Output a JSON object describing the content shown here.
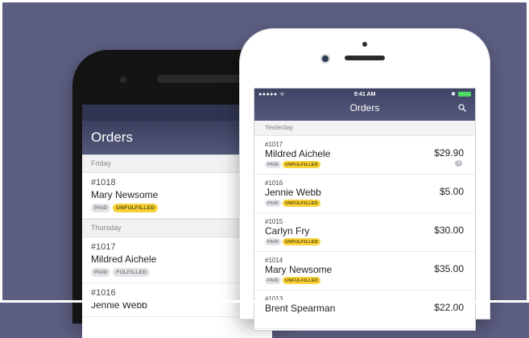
{
  "android": {
    "title": "Orders",
    "sections": [
      {
        "label": "Friday",
        "orders": [
          {
            "number": "#1018",
            "customer": "Mary Newsome",
            "payment": "PAID",
            "fulfillment": "UNFULFILLED"
          }
        ]
      },
      {
        "label": "Thursday",
        "orders": [
          {
            "number": "#1017",
            "customer": "Mildred Aichele",
            "payment": "PAID",
            "fulfillment": "FULFILLED"
          },
          {
            "number": "#1016",
            "customer": "Jennie Webb"
          }
        ]
      }
    ]
  },
  "iphone": {
    "status": {
      "signal": "●●●●● ᯤ",
      "time": "9:41 AM",
      "bluetooth": "✱"
    },
    "title": "Orders",
    "section": "Yesterday",
    "orders": [
      {
        "number": "#1017",
        "customer": "Mildred Aichele",
        "payment": "PAID",
        "fulfillment": "UNFULFILLED",
        "price": "$29.90",
        "comment_count": "3"
      },
      {
        "number": "#1016",
        "customer": "Jennie Webb",
        "payment": "PAID",
        "fulfillment": "UNFULFILLED",
        "price": "$5.00"
      },
      {
        "number": "#1015",
        "customer": "Carlyn Fry",
        "payment": "PAID",
        "fulfillment": "UNFULFILLED",
        "price": "$30.00"
      },
      {
        "number": "#1014",
        "customer": "Mary Newsome",
        "payment": "PAID",
        "fulfillment": "UNFULFILLED",
        "price": "$35.00"
      },
      {
        "number": "#1013",
        "customer": "Brent Spearman",
        "price": "$22.00"
      }
    ]
  },
  "colors": {
    "background": "#5d5f82",
    "header": "#3e4263",
    "unfulfilled_badge": "#f8d23a",
    "paid_badge": "#e2e3e7"
  },
  "icons": {
    "search": "search-icon",
    "comment": "comment-icon"
  }
}
